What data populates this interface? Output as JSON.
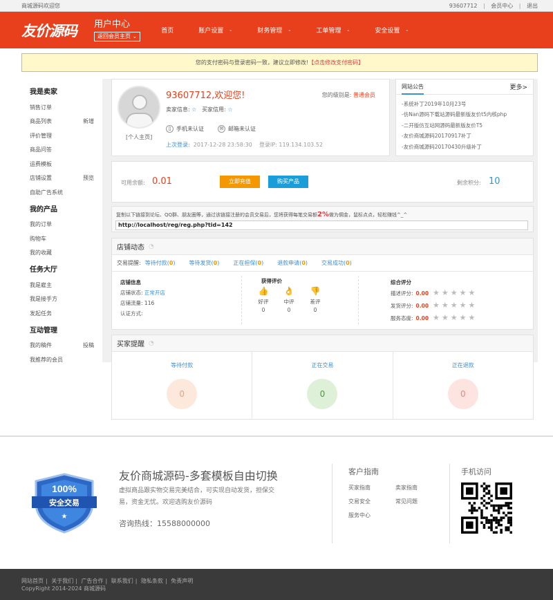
{
  "topbar": {
    "welcome": "商城源码欢迎您",
    "user_id": "93607712",
    "member_center": "会员中心",
    "logout": "退出"
  },
  "header": {
    "logo_text": "友价源码",
    "center_title": "用户中心",
    "back_label": "返回会员主页",
    "nav": [
      {
        "label": "首页",
        "chevron": false
      },
      {
        "label": "账户设置",
        "chevron": true
      },
      {
        "label": "财务管理",
        "chevron": true
      },
      {
        "label": "工单管理",
        "chevron": true
      },
      {
        "label": "安全设置",
        "chevron": true
      }
    ]
  },
  "notice": {
    "text": "您的支付密码与登录密码一致，建议立即修改!",
    "link": "【点击修改支付密码】"
  },
  "sidebar": {
    "sections": [
      {
        "title": "我是卖家",
        "items": [
          {
            "label": "销售订单",
            "extra": ""
          },
          {
            "label": "商品列表",
            "extra": "新增"
          },
          {
            "label": "评价管理",
            "extra": ""
          },
          {
            "label": "商品问答",
            "extra": ""
          },
          {
            "label": "运费模板",
            "extra": ""
          },
          {
            "label": "店铺设置",
            "extra": "预览"
          },
          {
            "label": "自助广告系统",
            "extra": ""
          }
        ]
      },
      {
        "title": "我的产品",
        "items": [
          {
            "label": "我的订单",
            "extra": ""
          },
          {
            "label": "购物车",
            "extra": ""
          },
          {
            "label": "我的收藏",
            "extra": ""
          }
        ]
      },
      {
        "title": "任务大厅",
        "items": [
          {
            "label": "我是雇主",
            "extra": ""
          },
          {
            "label": "我是接手方",
            "extra": ""
          },
          {
            "label": "发起任务",
            "extra": ""
          }
        ]
      },
      {
        "title": "互动管理",
        "items": [
          {
            "label": "我的稿件",
            "extra": "投稿"
          },
          {
            "label": "我推荐的会员",
            "extra": ""
          }
        ]
      }
    ]
  },
  "welcome": {
    "greeting": "93607712,欢迎您!",
    "home_link": "[个人主页]",
    "level_label": "您的级别是:",
    "level_value": "普通会员",
    "seller_credit": "卖家信息:",
    "buyer_credit": "买家信用:",
    "phone_auth": "手机未认证",
    "email_auth": "邮箱未认证",
    "last_login_label": "上次登录:",
    "last_login_time": "2017-12-28 23:58:30",
    "login_ip": "登录IP: 119.134.103.52"
  },
  "announce": {
    "title": "网站公告",
    "more": "更多>",
    "items": [
      "-系统补丁2019年10月23号",
      "-仿Nan源码下载站源码最新版友价t5内核php",
      "-二开版仿互站网源码最新版友价T5",
      "-友价商城源码20170917补丁",
      "-友价商城源码20170430升级补丁"
    ]
  },
  "balance": {
    "label": "可用余额:",
    "value": "0.01",
    "recharge": "立即充值",
    "buy": "购买产品",
    "points_label": "剩余积分:",
    "points_value": "10"
  },
  "share": {
    "tip_before": "复制以下链接到论坛、QQ群、朋友圈等，通过该链接注册的会员交易后，您将获得每笔交易额",
    "pct": "2%",
    "tip_after": "做为佣金，鼠标点点，轻松赚钱^_^",
    "url": "http://localhost/reg/reg.php?tid=142"
  },
  "shop": {
    "title": "店铺动态",
    "trade_label": "交易提醒:",
    "trades": [
      {
        "label": "等待付款",
        "count": "0"
      },
      {
        "label": "等待发货",
        "count": "0"
      },
      {
        "label": "正在担保",
        "count": "0"
      },
      {
        "label": "退款申请",
        "count": "0"
      },
      {
        "label": "交易成功",
        "count": "0"
      }
    ],
    "info_title": "店铺信息",
    "status_label": "店铺状态:",
    "status_value": "正常开店",
    "traffic_label": "店铺流量:",
    "traffic_value": "116",
    "cert_label": "认证方式:",
    "eval_title": "获得评价",
    "evals": [
      {
        "label": "好评",
        "count": "0"
      },
      {
        "label": "中评",
        "count": "0"
      },
      {
        "label": "差评",
        "count": "0"
      }
    ],
    "score_title": "综合评分",
    "scores": [
      {
        "label": "描述评分:",
        "value": "0.00"
      },
      {
        "label": "发货评分:",
        "value": "0.00"
      },
      {
        "label": "服务态度:",
        "value": "0.00"
      }
    ]
  },
  "buyer": {
    "title": "买家提醒",
    "cols": [
      {
        "label": "等待付款",
        "count": "0"
      },
      {
        "label": "正在交易",
        "count": "0"
      },
      {
        "label": "正在退款",
        "count": "0"
      }
    ]
  },
  "footer": {
    "badge_pct": "100%",
    "badge_text": "安全交易",
    "title": "友价商城源码-多套模板自由切换",
    "desc": "虚拟商品跟实物交易完美结合，可实现自动发货，担保交易，资金无忧。欢迎选购友价源码",
    "hotline": "咨询热线：15588000000",
    "guide_title": "客户指南",
    "guide_links": [
      "买家指南",
      "卖家指南",
      "交易安全",
      "常见问题",
      "服务中心"
    ],
    "mobile_title": "手机访问"
  },
  "bottom": {
    "links": [
      "网站首页",
      "关于我们",
      "广告合作",
      "联系我们",
      "隐私条款",
      "免责声明"
    ],
    "copyright": "CopyRight 2014-2024 商城源码"
  }
}
